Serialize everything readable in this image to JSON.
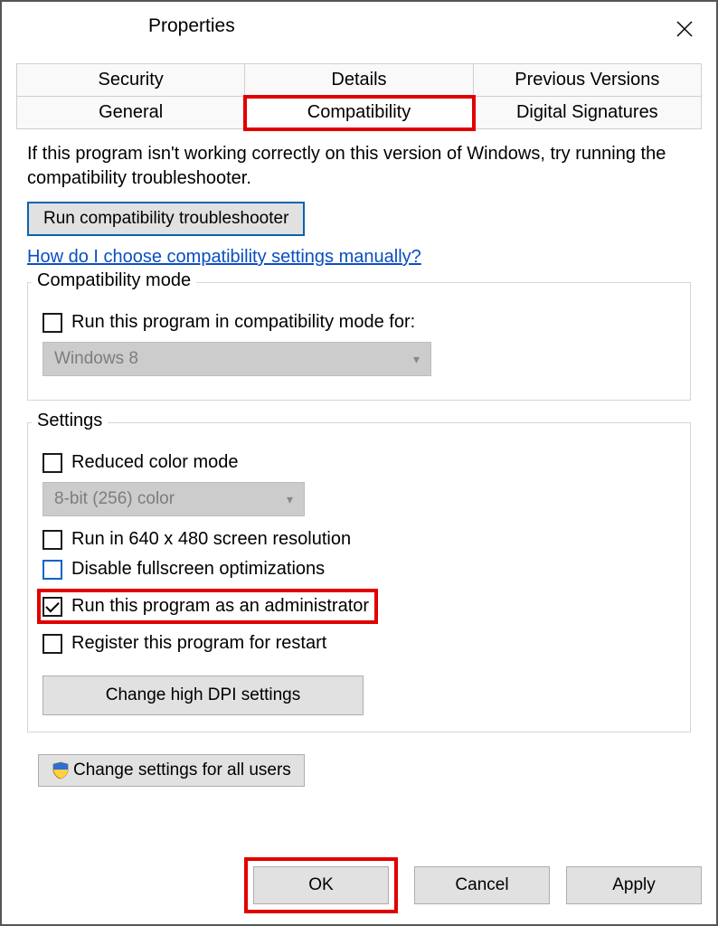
{
  "window": {
    "title": "Properties"
  },
  "tabs": {
    "row1": [
      "Security",
      "Details",
      "Previous Versions"
    ],
    "row2": [
      "General",
      "Compatibility",
      "Digital Signatures"
    ],
    "active": "Compatibility"
  },
  "intro": "If this program isn't working correctly on this version of Windows, try running the compatibility troubleshooter.",
  "troubleshooter_btn": "Run compatibility troubleshooter",
  "help_link": "How do I choose compatibility settings manually?",
  "compat_mode": {
    "group_label": "Compatibility mode",
    "checkbox_label": "Run this program in compatibility mode for:",
    "select_value": "Windows 8"
  },
  "settings": {
    "group_label": "Settings",
    "reduced_color_label": "Reduced color mode",
    "color_select_value": "8-bit (256) color",
    "run_640_label": "Run in 640 x 480 screen resolution",
    "disable_fullscreen_label": "Disable fullscreen optimizations",
    "run_admin_label": "Run this program as an administrator",
    "register_restart_label": "Register this program for restart",
    "dpi_btn": "Change high DPI settings"
  },
  "all_users_btn": "Change settings for all users",
  "buttons": {
    "ok": "OK",
    "cancel": "Cancel",
    "apply": "Apply"
  }
}
